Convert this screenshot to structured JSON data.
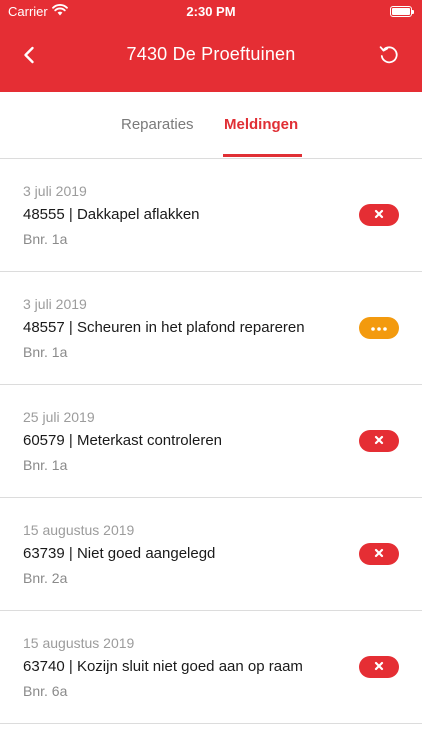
{
  "status_bar": {
    "carrier": "Carrier",
    "time": "2:30 PM"
  },
  "header": {
    "title": "7430 De Proeftuinen"
  },
  "tabs": [
    {
      "label": "Reparaties",
      "active": false
    },
    {
      "label": "Meldingen",
      "active": true
    }
  ],
  "colors": {
    "brand": "#e52e34",
    "pending": "#f39a0e",
    "muted": "#9c9c9c"
  },
  "items": [
    {
      "date": "3 juli 2019",
      "title": "48555 | Dakkapel aflakken",
      "bnr": "Bnr. 1a",
      "status_icon": "close-icon",
      "status_color": "#e52e34"
    },
    {
      "date": "3 juli 2019",
      "title": "48557 | Scheuren in het plafond repareren",
      "bnr": "Bnr. 1a",
      "status_icon": "more-dots-icon",
      "status_color": "#f39a0e"
    },
    {
      "date": "25 juli 2019",
      "title": "60579 | Meterkast controleren",
      "bnr": "Bnr. 1a",
      "status_icon": "close-icon",
      "status_color": "#e52e34"
    },
    {
      "date": "15 augustus 2019",
      "title": "63739 | Niet goed aangelegd",
      "bnr": "Bnr. 2a",
      "status_icon": "close-icon",
      "status_color": "#e52e34"
    },
    {
      "date": "15 augustus 2019",
      "title": "63740 | Kozijn sluit niet goed aan op raam",
      "bnr": "Bnr. 6a",
      "status_icon": "close-icon",
      "status_color": "#e52e34"
    }
  ]
}
